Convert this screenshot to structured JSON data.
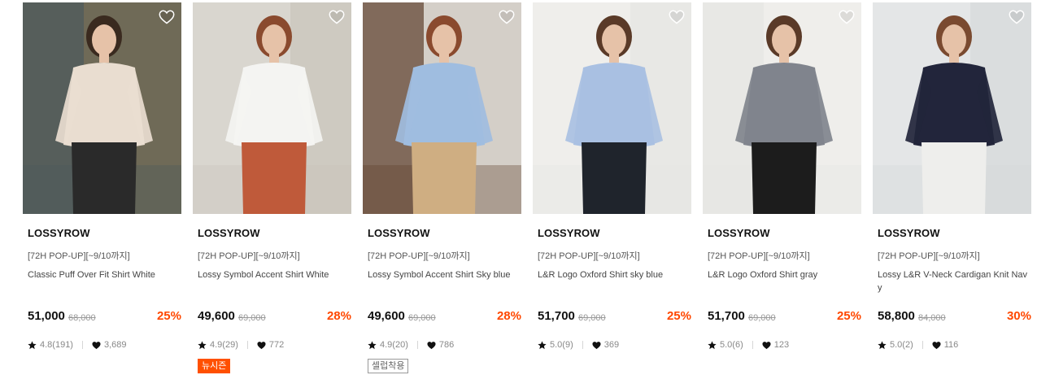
{
  "products": [
    {
      "brand": "LOSSYROW",
      "promo": "[72H POP-UP][~9/10까지]",
      "name": "Classic Puff Over Fit Shirt White",
      "price": "51,000",
      "original_price": "68,000",
      "discount": "25%",
      "rating": "4.8(191)",
      "likes": "3,689",
      "tag": null,
      "photo_palette": {
        "bg": "#6f6a57",
        "wall": "#4b5a5c",
        "shirt": "#e9ddd0",
        "hair": "#3a2a1f",
        "pants": "#2a2a2a"
      }
    },
    {
      "brand": "LOSSYROW",
      "promo": "[72H POP-UP][~9/10까지]",
      "name": "Lossy Symbol Accent Shirt White",
      "price": "49,600",
      "original_price": "69,000",
      "discount": "28%",
      "rating": "4.9(29)",
      "likes": "772",
      "tag": {
        "label": "뉴시즌",
        "style": "new"
      },
      "photo_palette": {
        "bg": "#d9d6cf",
        "wall": "#c9c4bb",
        "shirt": "#f4f4f2",
        "hair": "#8a4a2e",
        "pants": "#bf5a3a"
      }
    },
    {
      "brand": "LOSSYROW",
      "promo": "[72H POP-UP][~9/10까지]",
      "name": "Lossy Symbol Accent Shirt Sky blue",
      "price": "49,600",
      "original_price": "69,000",
      "discount": "28%",
      "rating": "4.9(20)",
      "likes": "786",
      "tag": {
        "label": "셀럽착용",
        "style": "celeb"
      },
      "photo_palette": {
        "bg": "#d4cfc8",
        "wall": "#5e3f2c",
        "shirt": "#9fbde0",
        "hair": "#8a4a2e",
        "pants": "#cfae82"
      }
    },
    {
      "brand": "LOSSYROW",
      "promo": "[72H POP-UP][~9/10까지]",
      "name": "L&R Logo Oxford Shirt sky blue",
      "price": "51,700",
      "original_price": "69,000",
      "discount": "25%",
      "rating": "5.0(9)",
      "likes": "369",
      "tag": null,
      "photo_palette": {
        "bg": "#efeeeb",
        "wall": "#e6e5e2",
        "shirt": "#a9c0e2",
        "hair": "#5a3a28",
        "pants": "#1f242c"
      }
    },
    {
      "brand": "LOSSYROW",
      "promo": "[72H POP-UP][~9/10까지]",
      "name": "L&R Logo Oxford Shirt gray",
      "price": "51,700",
      "original_price": "69,000",
      "discount": "25%",
      "rating": "5.0(6)",
      "likes": "123",
      "tag": null,
      "photo_palette": {
        "bg": "#efeeeb",
        "wall": "#e6e5e2",
        "shirt": "#80848d",
        "hair": "#5a3a28",
        "pants": "#1c1c1c"
      }
    },
    {
      "brand": "LOSSYROW",
      "promo": "[72H POP-UP][~9/10까지]",
      "name": "Lossy L&R V-Neck Cardigan Knit Navy",
      "price": "58,800",
      "original_price": "84,000",
      "discount": "30%",
      "rating": "5.0(2)",
      "likes": "116",
      "tag": null,
      "photo_palette": {
        "bg": "#e4e6e7",
        "wall": "#d5d8da",
        "shirt": "#22253b",
        "hair": "#7a4a30",
        "pants": "#eeeeec"
      }
    }
  ],
  "colors": {
    "discount": "#ff4800",
    "tag_new": "#ff5000",
    "text": "#111111",
    "muted": "#888888"
  },
  "icons": {
    "wishlist": "heart-outline-icon",
    "rating": "star-icon",
    "likes": "heart-filled-icon"
  }
}
